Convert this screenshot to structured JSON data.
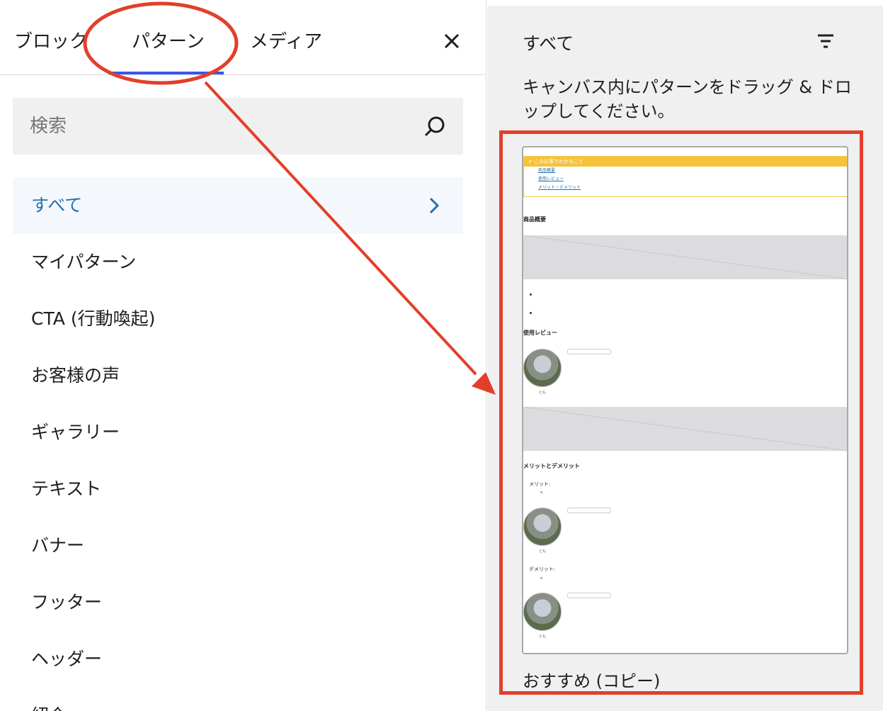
{
  "tabs": {
    "blocks": "ブロック",
    "patterns": "パターン",
    "media": "メディア"
  },
  "search": {
    "placeholder": "検索"
  },
  "categories": [
    "すべて",
    "マイパターン",
    "CTA (行動喚起)",
    "お客様の声",
    "ギャラリー",
    "テキスト",
    "バナー",
    "フッター",
    "ヘッダー",
    "紹介"
  ],
  "right": {
    "title": "すべて",
    "help": "キャンバス内にパターンをドラッグ & ドロップしてください。",
    "pattern_label": "おすすめ (コピー)"
  },
  "preview": {
    "box_head": "✔ この記事でわかること",
    "links": [
      "商品概要",
      "使用レビュー",
      "メリット・デメリット"
    ],
    "h_overview": "商品概要",
    "h_review": "使用レビュー",
    "h_merits": "メリットとデメリット",
    "merit": "メリット:",
    "demerit": "デメリット:",
    "avatar_name": "とも"
  },
  "colors": {
    "accent": "#3858e9",
    "active_text": "#2271b1",
    "annotation": "#e23f2a",
    "preview_yellow": "#f5c23a"
  }
}
